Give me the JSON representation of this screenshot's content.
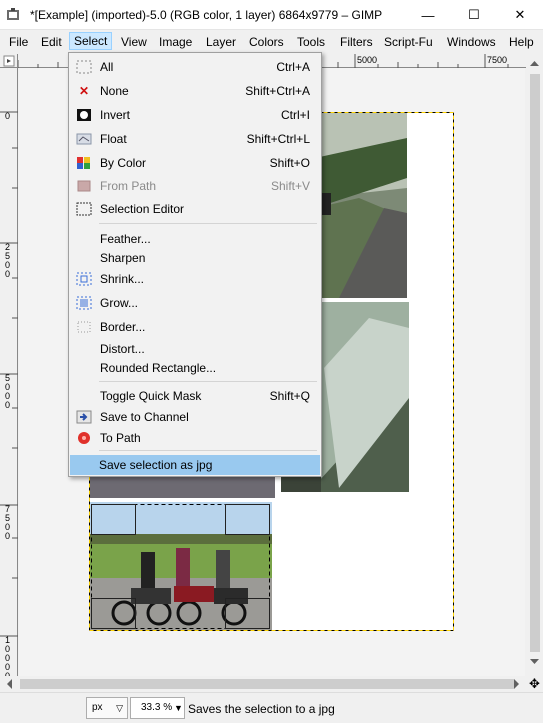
{
  "window": {
    "title": "*[Example] (imported)-5.0 (RGB color, 1 layer) 6864x9779 – GIMP",
    "app_icon": "gimp-icon",
    "controls": {
      "minimize": "—",
      "maximize": "☐",
      "close": "✕"
    }
  },
  "menubar": [
    {
      "label": "File",
      "mnemonic": "F"
    },
    {
      "label": "Edit",
      "mnemonic": "E"
    },
    {
      "label": "Select",
      "mnemonic": "S",
      "active": true
    },
    {
      "label": "View",
      "mnemonic": "V"
    },
    {
      "label": "Image",
      "mnemonic": "I"
    },
    {
      "label": "Layer",
      "mnemonic": "L"
    },
    {
      "label": "Colors",
      "mnemonic": "C"
    },
    {
      "label": "Tools",
      "mnemonic": "T"
    },
    {
      "label": "Filters",
      "mnemonic": "r"
    },
    {
      "label": "Script-Fu",
      "mnemonic": "p"
    },
    {
      "label": "Windows",
      "mnemonic": "W"
    },
    {
      "label": "Help",
      "mnemonic": "H"
    }
  ],
  "ruler": {
    "horizontal_labels": [
      "5000",
      "7500"
    ],
    "vertical_labels": [
      "0",
      "2500",
      "5000",
      "7500",
      "10000"
    ]
  },
  "select_menu": {
    "items": [
      {
        "label": "All",
        "shortcut": "Ctrl+A",
        "icon": "select-all-icon"
      },
      {
        "label": "None",
        "shortcut": "Shift+Ctrl+A",
        "icon": "select-none-icon"
      },
      {
        "label": "Invert",
        "shortcut": "Ctrl+I",
        "icon": "invert-icon"
      },
      {
        "label": "Float",
        "shortcut": "Shift+Ctrl+L",
        "icon": "float-icon"
      },
      {
        "label": "By Color",
        "shortcut": "Shift+O",
        "icon": "by-color-icon"
      },
      {
        "label": "From Path",
        "shortcut": "Shift+V",
        "icon": "from-path-icon",
        "disabled": true
      },
      {
        "label": "Selection Editor",
        "shortcut": "",
        "icon": "selection-editor-icon"
      },
      {
        "label": "Feather...",
        "shortcut": "",
        "icon": ""
      },
      {
        "label": "Sharpen",
        "shortcut": "",
        "icon": ""
      },
      {
        "label": "Shrink...",
        "shortcut": "",
        "icon": "shrink-icon"
      },
      {
        "label": "Grow...",
        "shortcut": "",
        "icon": "grow-icon"
      },
      {
        "label": "Border...",
        "shortcut": "",
        "icon": "border-icon"
      },
      {
        "label": "Distort...",
        "shortcut": "",
        "icon": ""
      },
      {
        "label": "Rounded Rectangle...",
        "shortcut": "",
        "icon": ""
      },
      {
        "label": "Toggle Quick Mask",
        "shortcut": "Shift+Q",
        "icon": ""
      },
      {
        "label": "Save to Channel",
        "shortcut": "",
        "icon": "save-channel-icon"
      },
      {
        "label": "To Path",
        "shortcut": "",
        "icon": "to-path-icon"
      },
      {
        "label": "Save selection as jpg",
        "shortcut": "",
        "icon": "",
        "highlighted": true
      }
    ]
  },
  "statusbar": {
    "unit": "px",
    "zoom": "33.3 %",
    "message": "Saves the selection to a jpg"
  },
  "colors": {
    "menu_active_bg": "#cce8ff",
    "menu_hover_bg": "#99c9ef",
    "canvas_bg": "#f3f3f3",
    "selection_marquee": "#000000"
  }
}
